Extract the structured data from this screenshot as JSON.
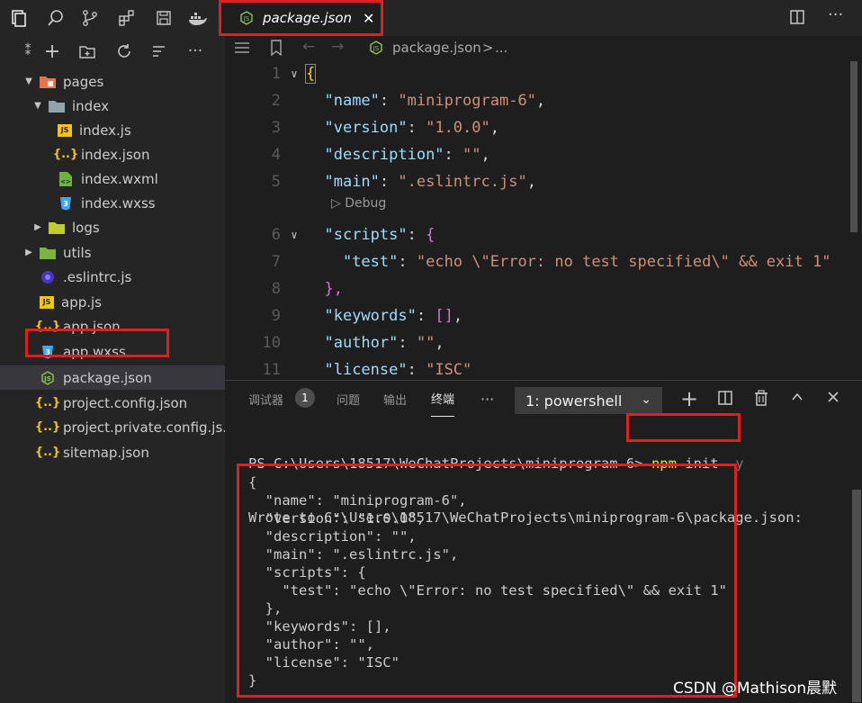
{
  "tab": {
    "filename": "package.json",
    "close": "✕"
  },
  "breadcrumb": {
    "filename": "package.json",
    "separator": ">",
    "ellipsis": "..."
  },
  "sidebar": {
    "items": [
      {
        "label": "pages",
        "icon": "folder-pages-icon"
      },
      {
        "label": "index",
        "icon": "folder-open-icon"
      },
      {
        "label": "index.js",
        "icon": "js-file-icon"
      },
      {
        "label": "index.json",
        "icon": "json-file-icon"
      },
      {
        "label": "index.wxml",
        "icon": "wxml-file-icon"
      },
      {
        "label": "index.wxss",
        "icon": "css-file-icon"
      },
      {
        "label": "logs",
        "icon": "folder-icon"
      },
      {
        "label": "utils",
        "icon": "folder-icon"
      },
      {
        "label": ".eslintrc.js",
        "icon": "eslint-file-icon"
      },
      {
        "label": "app.js",
        "icon": "js-file-icon"
      },
      {
        "label": "app.json",
        "icon": "json-file-icon"
      },
      {
        "label": "app.wxss",
        "icon": "css-file-icon"
      },
      {
        "label": "package.json",
        "icon": "nodejs-file-icon"
      },
      {
        "label": "project.config.json",
        "icon": "json-file-icon"
      },
      {
        "label": "project.private.config.js...",
        "icon": "json-file-icon"
      },
      {
        "label": "sitemap.json",
        "icon": "json-file-icon"
      }
    ]
  },
  "editor": {
    "line_numbers": [
      "1",
      "2",
      "3",
      "4",
      "5",
      "6",
      "7",
      "8",
      "9",
      "10",
      "11"
    ],
    "codelens": "▷ Debug",
    "lines": {
      "l1": "{",
      "l2k": "\"name\"",
      "l2v": "\"miniprogram-6\"",
      "l3k": "\"version\"",
      "l3v": "\"1.0.0\"",
      "l4k": "\"description\"",
      "l4v": "\"\"",
      "l5k": "\"main\"",
      "l5v": "\".eslintrc.js\"",
      "l6k": "\"scripts\"",
      "l7k": "\"test\"",
      "l7v": "\"echo \\\"Error: no test specified\\\" && exit 1\"",
      "l8": "},",
      "l9k": "\"keywords\"",
      "l9v": "[]",
      "l10k": "\"author\"",
      "l10v": "\"\"",
      "l11k": "\"license\"",
      "l11v": "\"ISC\""
    }
  },
  "panel": {
    "tabs": [
      "调试器",
      "问题",
      "输出",
      "终端"
    ],
    "debugger_badge": "1",
    "more": "···",
    "terminal_select": "1: powershell",
    "terminal": {
      "prompt": "PS C:\\Users\\18517\\WeChatProjects\\miniprogram-6> ",
      "cmd_npm": "npm",
      "cmd_rest": " init ",
      "cmd_flag": "-y",
      "wrote": "Wrote to C:\\Users\\18517\\WeChatProjects\\miniprogram-6\\package.json:",
      "output": "{\n  \"name\": \"miniprogram-6\",\n  \"version\": \"1.0.0\",\n  \"description\": \"\",\n  \"main\": \".eslintrc.js\",\n  \"scripts\": {\n    \"test\": \"echo \\\"Error: no test specified\\\" && exit 1\"\n  },\n  \"keywords\": [],\n  \"author\": \"\",\n  \"license\": \"ISC\"\n}"
    }
  },
  "watermark": "CSDN @Mathison晨默",
  "colors": {
    "highlight_red": "#e0201e",
    "string": "#ce9178",
    "key": "#9cdcfe"
  }
}
